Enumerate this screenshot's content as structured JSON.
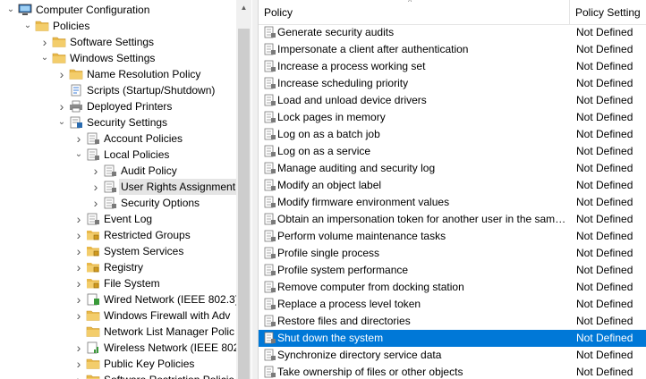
{
  "tree": {
    "items": [
      {
        "label": "Computer Configuration",
        "level": 0,
        "chevron": "down",
        "icon": "computer-icon"
      },
      {
        "label": "Policies",
        "level": 1,
        "chevron": "down",
        "icon": "folder-icon"
      },
      {
        "label": "Software Settings",
        "level": 2,
        "chevron": "right",
        "icon": "folder-icon"
      },
      {
        "label": "Windows Settings",
        "level": 2,
        "chevron": "down",
        "icon": "folder-icon"
      },
      {
        "label": "Name Resolution Policy",
        "level": 3,
        "chevron": "right",
        "icon": "folder-icon"
      },
      {
        "label": "Scripts (Startup/Shutdown)",
        "level": 3,
        "chevron": "",
        "icon": "script-icon"
      },
      {
        "label": "Deployed Printers",
        "level": 3,
        "chevron": "right",
        "icon": "printer-icon"
      },
      {
        "label": "Security Settings",
        "level": 3,
        "chevron": "down",
        "icon": "security-settings-icon"
      },
      {
        "label": "Account Policies",
        "level": 4,
        "chevron": "right",
        "icon": "policy-folder-icon"
      },
      {
        "label": "Local Policies",
        "level": 4,
        "chevron": "down",
        "icon": "policy-folder-icon"
      },
      {
        "label": "Audit Policy",
        "level": 5,
        "chevron": "right",
        "icon": "policy-folder-icon"
      },
      {
        "label": "User Rights Assignment",
        "level": 5,
        "chevron": "right",
        "icon": "policy-folder-icon",
        "selected": true
      },
      {
        "label": "Security Options",
        "level": 5,
        "chevron": "right",
        "icon": "policy-folder-icon"
      },
      {
        "label": "Event Log",
        "level": 4,
        "chevron": "right",
        "icon": "policy-folder-icon"
      },
      {
        "label": "Restricted Groups",
        "level": 4,
        "chevron": "right",
        "icon": "lock-folder-icon"
      },
      {
        "label": "System Services",
        "level": 4,
        "chevron": "right",
        "icon": "lock-folder-icon"
      },
      {
        "label": "Registry",
        "level": 4,
        "chevron": "right",
        "icon": "lock-folder-icon"
      },
      {
        "label": "File System",
        "level": 4,
        "chevron": "right",
        "icon": "lock-folder-icon"
      },
      {
        "label": "Wired Network (IEEE 802.3)",
        "level": 4,
        "chevron": "right",
        "icon": "network-icon"
      },
      {
        "label": "Windows Firewall with Adv",
        "level": 4,
        "chevron": "right",
        "icon": "folder-icon"
      },
      {
        "label": "Network List Manager Polic",
        "level": 4,
        "chevron": "",
        "icon": "folder-icon"
      },
      {
        "label": "Wireless Network (IEEE 802.",
        "level": 4,
        "chevron": "right",
        "icon": "wireless-icon"
      },
      {
        "label": "Public Key Policies",
        "level": 4,
        "chevron": "right",
        "icon": "folder-icon"
      },
      {
        "label": "Software Restriction Policie",
        "level": 4,
        "chevron": "right",
        "icon": "folder-icon"
      }
    ]
  },
  "list": {
    "columns": {
      "policy": "Policy",
      "setting": "Policy Setting"
    },
    "rows": [
      {
        "name": "Generate security audits",
        "value": "Not Defined"
      },
      {
        "name": "Impersonate a client after authentication",
        "value": "Not Defined"
      },
      {
        "name": "Increase a process working set",
        "value": "Not Defined"
      },
      {
        "name": "Increase scheduling priority",
        "value": "Not Defined"
      },
      {
        "name": "Load and unload device drivers",
        "value": "Not Defined"
      },
      {
        "name": "Lock pages in memory",
        "value": "Not Defined"
      },
      {
        "name": "Log on as a batch job",
        "value": "Not Defined"
      },
      {
        "name": "Log on as a service",
        "value": "Not Defined"
      },
      {
        "name": "Manage auditing and security log",
        "value": "Not Defined"
      },
      {
        "name": "Modify an object label",
        "value": "Not Defined"
      },
      {
        "name": "Modify firmware environment values",
        "value": "Not Defined"
      },
      {
        "name": "Obtain an impersonation token for another user in the same...",
        "value": "Not Defined"
      },
      {
        "name": "Perform volume maintenance tasks",
        "value": "Not Defined"
      },
      {
        "name": "Profile single process",
        "value": "Not Defined"
      },
      {
        "name": "Profile system performance",
        "value": "Not Defined"
      },
      {
        "name": "Remove computer from docking station",
        "value": "Not Defined"
      },
      {
        "name": "Replace a process level token",
        "value": "Not Defined"
      },
      {
        "name": "Restore files and directories",
        "value": "Not Defined"
      },
      {
        "name": "Shut down the system",
        "value": "Not Defined",
        "selected": true
      },
      {
        "name": "Synchronize directory service data",
        "value": "Not Defined"
      },
      {
        "name": "Take ownership of files or other objects",
        "value": "Not Defined"
      }
    ]
  },
  "colors": {
    "selection": "#0078d7",
    "tree_selection": "#e5e5e5",
    "folder": "#e8b84a"
  }
}
